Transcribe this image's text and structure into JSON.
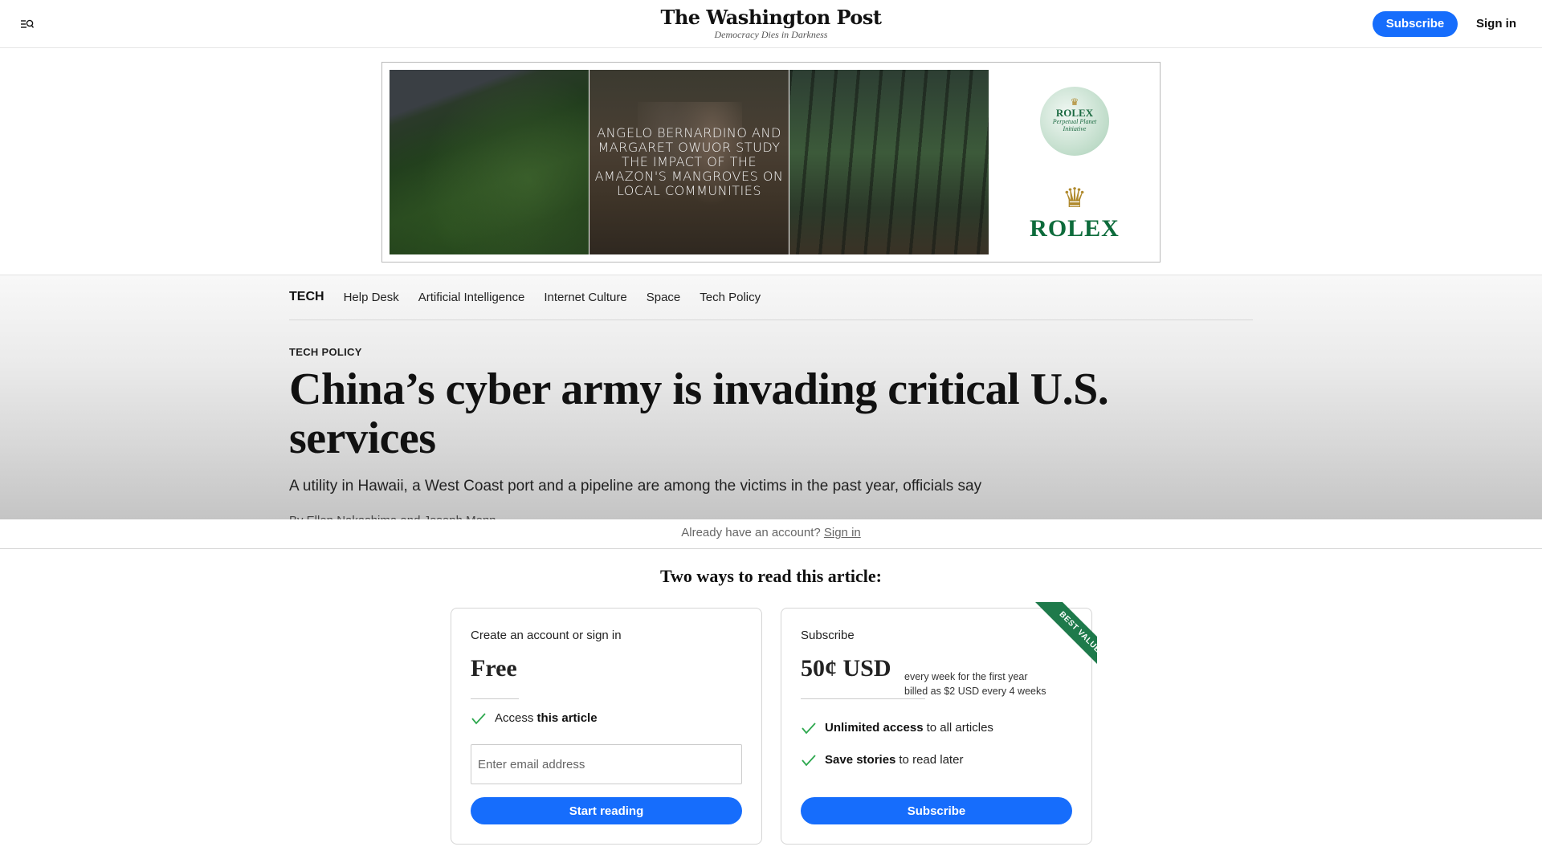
{
  "header": {
    "menu_icon": "menu-search-icon",
    "logo_title": "The Washington Post",
    "logo_tagline": "Democracy Dies in Darkness",
    "subscribe_label": "Subscribe",
    "signin_label": "Sign in",
    "accent_color": "#166dfc"
  },
  "ad": {
    "caption": "ANGELO BERNARDINO AND MARGARET OWUOR STUDY THE IMPACT OF THE AMAZON'S MANGROVES ON LOCAL COMMUNITIES",
    "globe_brand": "ROLEX",
    "globe_sub_line1": "Perpetual Planet",
    "globe_sub_line2": "Initiative",
    "brand": "ROLEX",
    "brand_color": "#0d6b3b"
  },
  "section_nav": {
    "section": "TECH",
    "items": [
      {
        "label": "Help Desk"
      },
      {
        "label": "Artificial Intelligence"
      },
      {
        "label": "Internet Culture"
      },
      {
        "label": "Space"
      },
      {
        "label": "Tech Policy"
      }
    ]
  },
  "article": {
    "kicker": "TECH POLICY",
    "headline": "China’s cyber army is invading critical U.S. services",
    "dek": "A utility in Hawaii, a West Coast port and a pipeline are among the victims in the past year, officials say",
    "byline": "By Ellen Nakashima and Joseph Menn"
  },
  "paywall": {
    "signin_prompt": "Already have an account?",
    "signin_link": "Sign in",
    "title": "Two ways to read this article:",
    "free_card": {
      "eyebrow": "Create an account or sign in",
      "price": "Free",
      "features": [
        {
          "prefix": "Access",
          "bold": "this article",
          "suffix": ""
        }
      ],
      "email_placeholder": "Enter email address",
      "email_value": "",
      "cta": "Start reading"
    },
    "subscribe_card": {
      "eyebrow": "Subscribe",
      "price": "50¢ USD",
      "price_note_line1": "every week for the first year",
      "price_note_line2": "billed as $2 USD every 4 weeks",
      "ribbon": "BEST VALUE",
      "ribbon_color": "#1e7a4b",
      "features": [
        {
          "bold": "Unlimited access",
          "suffix": "to all articles"
        },
        {
          "bold": "Save stories",
          "suffix": "to read later"
        }
      ],
      "cta": "Subscribe"
    },
    "check_color": "#2ea84f"
  }
}
